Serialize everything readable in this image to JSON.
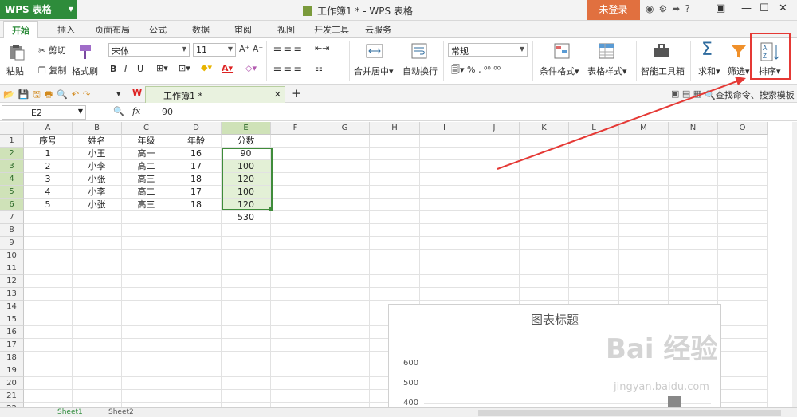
{
  "app": {
    "title": "WPS 表格",
    "window_title": "工作簿1 * - WPS 表格",
    "login": "未登录"
  },
  "ribbon_tabs": [
    "开始",
    "插入",
    "页面布局",
    "公式",
    "数据",
    "审阅",
    "视图",
    "开发工具",
    "云服务"
  ],
  "ribbon": {
    "paste": "粘贴",
    "cut": "剪切",
    "copy": "复制",
    "format_painter": "格式刷",
    "font_name": "宋体",
    "font_size": "11",
    "merge_center": "合并居中",
    "wrap_text": "自动换行",
    "number_format": "常规",
    "conditional_format": "条件格式",
    "table_style": "表格样式",
    "smart_toolbox": "智能工具箱",
    "sum": "求和",
    "filter": "筛选",
    "sort": "排序"
  },
  "quickbar": {
    "doc_tab": "工作簿1 *",
    "search": "查找命令、搜索模板"
  },
  "formula_bar": {
    "name_box": "E2",
    "fx": "fx",
    "value": "90"
  },
  "sheet": {
    "columns": [
      "A",
      "B",
      "C",
      "D",
      "E",
      "F",
      "G",
      "H",
      "I",
      "J",
      "K",
      "L",
      "M",
      "N",
      "O"
    ],
    "row_numbers": [
      "1",
      "2",
      "3",
      "4",
      "5",
      "6",
      "7",
      "8",
      "9",
      "10",
      "11",
      "12",
      "13",
      "14",
      "15",
      "16",
      "17",
      "18",
      "19",
      "20",
      "21",
      "22"
    ],
    "rows": [
      [
        "序号",
        "姓名",
        "年级",
        "年龄",
        "分数"
      ],
      [
        "1",
        "小王",
        "高一",
        "16",
        "90"
      ],
      [
        "2",
        "小李",
        "高二",
        "17",
        "100"
      ],
      [
        "3",
        "小张",
        "高三",
        "18",
        "120"
      ],
      [
        "4",
        "小李",
        "高二",
        "17",
        "100"
      ],
      [
        "5",
        "小张",
        "高三",
        "18",
        "120"
      ],
      [
        "",
        "",
        "",
        "",
        "530"
      ]
    ]
  },
  "chart": {
    "title": "图表标题",
    "y_ticks": [
      "600",
      "500",
      "400"
    ]
  },
  "sheet_tabs": [
    "Sheet1",
    "Sheet2"
  ],
  "watermark": {
    "brand": "Bai 经验",
    "url": "jingyan.baidu.com"
  },
  "colors": {
    "accent": "#2e8c3b",
    "login": "#e1703f",
    "highlight": "#e53935"
  }
}
